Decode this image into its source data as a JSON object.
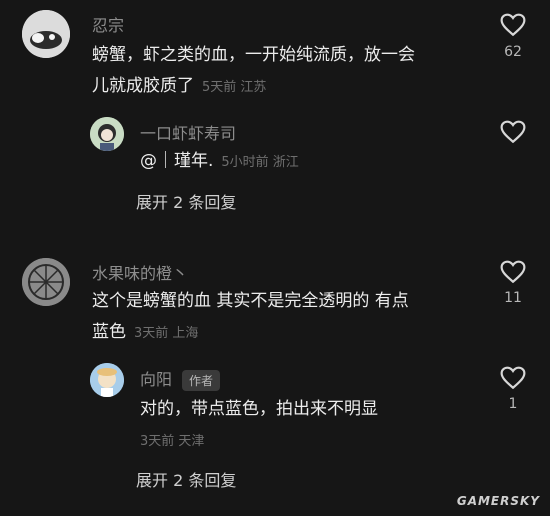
{
  "comments": [
    {
      "author": "忍宗",
      "text_line1": "螃蟹，虾之类的血，一开始纯流质，放一会",
      "text_line2": "儿就成胶质了",
      "meta": "5天前 江苏",
      "likes": "62",
      "reply": {
        "author": "一口虾虾寿司",
        "text": "@｜瑾年.",
        "meta": "5小时前 浙江"
      },
      "expand": "展开 2 条回复"
    },
    {
      "author": "水果味的橙丶",
      "text_line1": "这个是螃蟹的血 其实不是完全透明的 有点",
      "text_line2": "蓝色",
      "meta": "3天前 上海",
      "likes": "11",
      "reply": {
        "author": "向阳",
        "badge": "作者",
        "text": "对的，带点蓝色，拍出来不明显",
        "meta": "3天前 天津",
        "likes": "1"
      },
      "expand": "展开 2 条回复"
    }
  ],
  "watermark": "GAMERSKY",
  "icons": [
    "heart-icon"
  ]
}
